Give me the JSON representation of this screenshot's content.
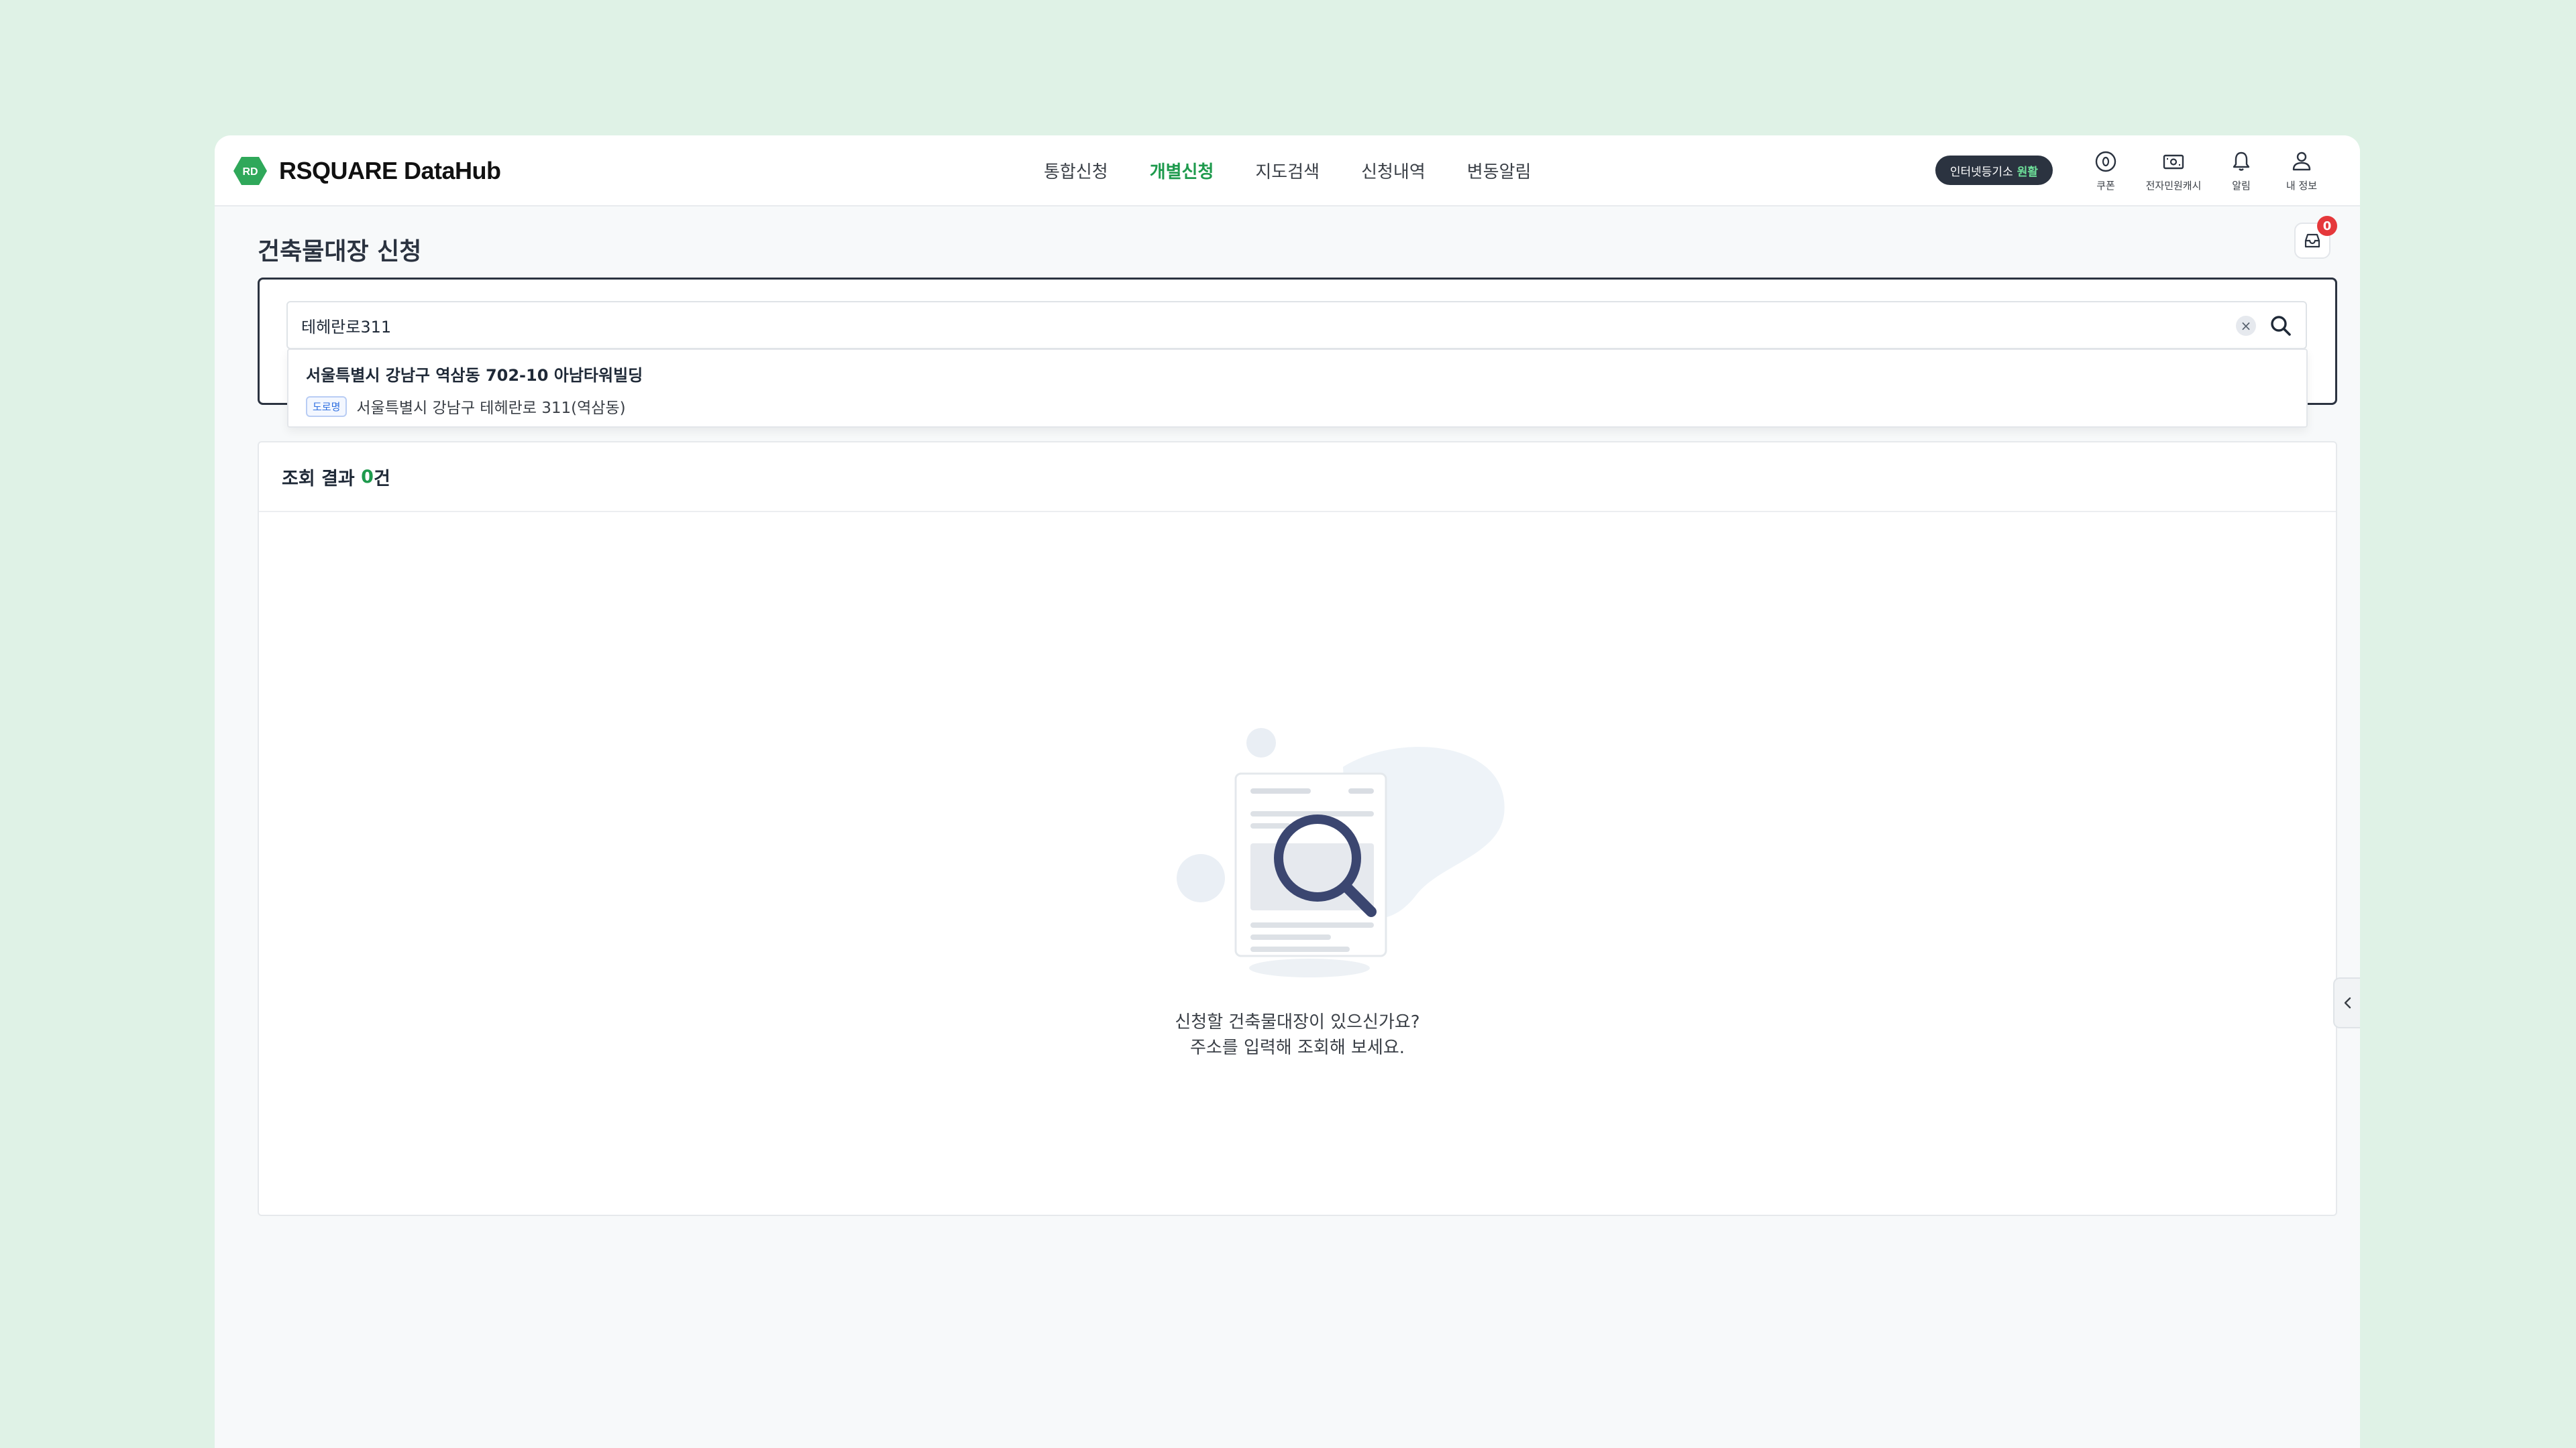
{
  "header": {
    "logo_text": "RSQUARE DataHub",
    "logo_mark": "RD",
    "nav": [
      {
        "label": "통합신청"
      },
      {
        "label": "개별신청"
      },
      {
        "label": "지도검색"
      },
      {
        "label": "신청내역"
      },
      {
        "label": "변동알림"
      }
    ],
    "active_nav": "개별신청",
    "registry_label": "인터넷등기소",
    "registry_status": "원활",
    "menu": {
      "coupon_label": "쿠폰",
      "cash_label": "전자민원캐시",
      "alert_label": "알림",
      "profile_label": "내 정보"
    }
  },
  "page": {
    "title": "건축물대장 신청",
    "inbox_badge": "0"
  },
  "search": {
    "value": "테헤란로311",
    "clear_icon": "×"
  },
  "suggestion": {
    "title": "서울특별시 강남구 역삼동 702-10 아남타워빌딩",
    "tag": "도로명",
    "road_address": "서울특별시 강남구 테헤란로 311(역삼동)"
  },
  "results": {
    "label": "조회 결과",
    "count": "0",
    "unit": "건",
    "empty_line1": "신청할 건축물대장이 있으신가요?",
    "empty_line2": "주소를 입력해 조회해 보세요."
  },
  "colors": {
    "accent": "#1e9a4d",
    "background": "#dff2e6",
    "badge": "#e5383b",
    "dark": "#2b3340"
  }
}
